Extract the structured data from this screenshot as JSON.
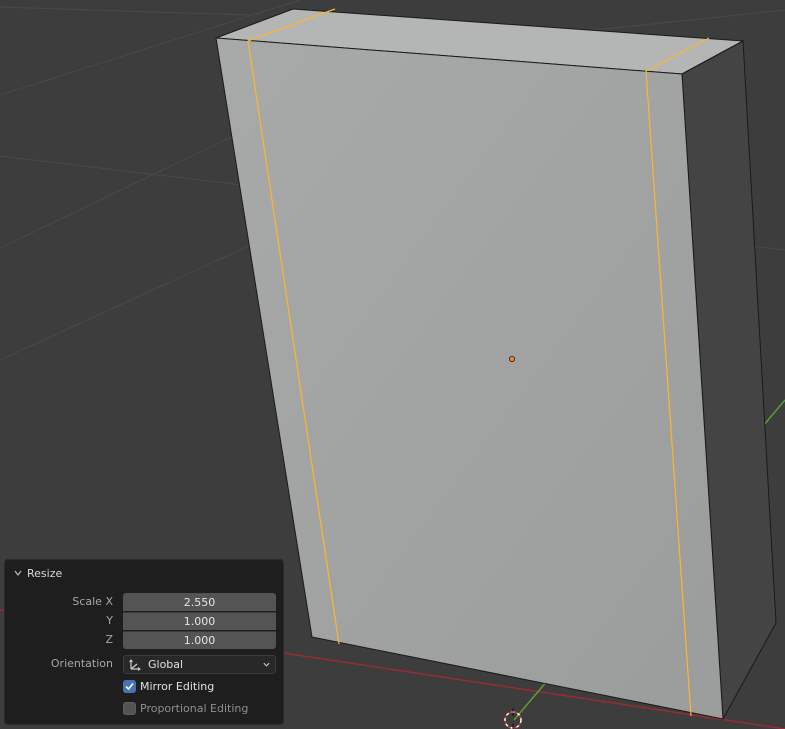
{
  "colors": {
    "background": "#3d3d3d",
    "face_front": "#a3a5a5",
    "face_side": "#444444",
    "face_top": "#b4b6b6",
    "selected_edge": "#ffb52b",
    "origin": "#ff8a1e",
    "x_axis": "#9a2a36",
    "y_axis": "#5aa02e",
    "checkbox_on": "#4772b3"
  },
  "operator_panel": {
    "title": "Resize",
    "scale_x_label": "Scale X",
    "scale_x": "2.550",
    "y_label": "Y",
    "y": "1.000",
    "z_label": "Z",
    "z": "1.000",
    "orientation_label": "Orientation",
    "orientation_value": "Global",
    "orientation_icon": "global-axes-icon",
    "mirror_editing_label": "Mirror Editing",
    "mirror_editing": true,
    "proportional_editing_label": "Proportional Editing",
    "proportional_editing": false
  }
}
